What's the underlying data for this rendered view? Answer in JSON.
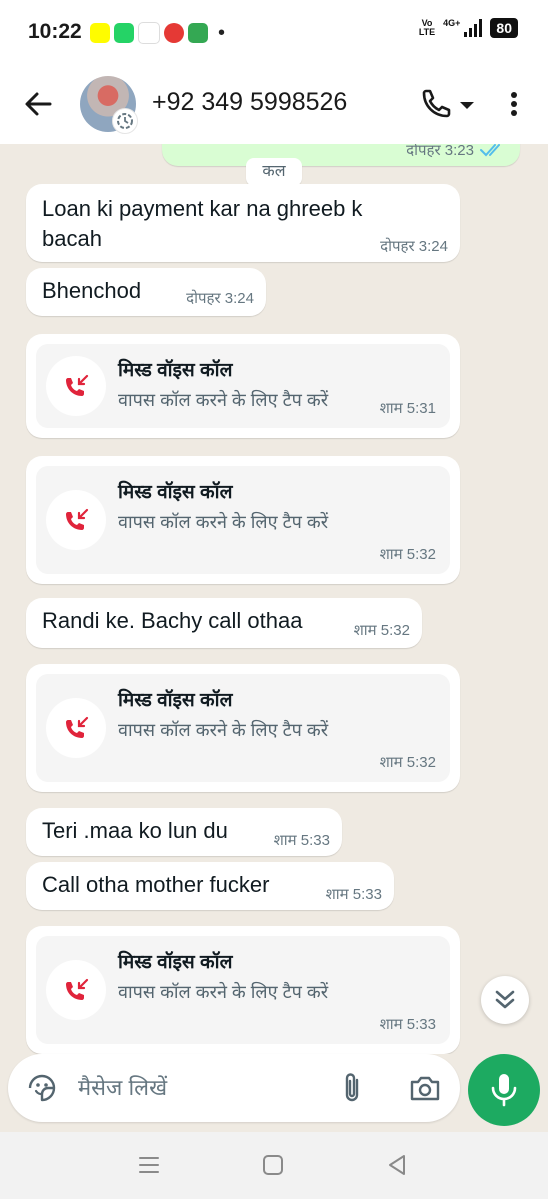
{
  "status_bar": {
    "time": "10:22",
    "notification_icons": [
      "snapchat-icon",
      "whatsapp-icon",
      "news-app-icon",
      "app-icon",
      "messages-icon"
    ],
    "dot": "•",
    "volte_top": "Vo",
    "volte_bottom": "LTE",
    "network": "4G+",
    "battery": "80"
  },
  "header": {
    "contact_name": "+92 349 5998526"
  },
  "chat": {
    "top_partial": {
      "time": "दोपहर 3:23"
    },
    "date_chip": "कल",
    "messages": [
      {
        "type": "text",
        "direction": "in",
        "text_line1": "Loan ki payment kar na ghreeb k",
        "text_line2": "bacah",
        "time": "दोपहर 3:24"
      },
      {
        "type": "text",
        "direction": "in",
        "text": "Bhenchod",
        "time": "दोपहर 3:24"
      },
      {
        "type": "call",
        "title": "मिस्ड  वॉइस कॉल",
        "subtitle": "वापस कॉल करने के लिए टैप करें",
        "time": "शाम 5:31"
      },
      {
        "type": "call",
        "title": "मिस्ड  वॉइस कॉल",
        "subtitle": "वापस कॉल करने के लिए टैप करें",
        "time": "शाम 5:32"
      },
      {
        "type": "text",
        "direction": "in",
        "text": "Randi ke. Bachy call othaa",
        "time": "शाम 5:32"
      },
      {
        "type": "call",
        "title": "मिस्ड  वॉइस कॉल",
        "subtitle": "वापस कॉल करने के लिए टैप करें",
        "time": "शाम 5:32"
      },
      {
        "type": "text",
        "direction": "in",
        "text": "Teri .maa ko lun du",
        "time": "शाम 5:33"
      },
      {
        "type": "text",
        "direction": "in",
        "text": "Call otha mother fucker",
        "time": "शाम 5:33"
      },
      {
        "type": "call",
        "title": "मिस्ड  वॉइस कॉल",
        "subtitle": "वापस कॉल करने के लिए टैप करें",
        "time": "शाम 5:33"
      }
    ]
  },
  "composer": {
    "placeholder": "मैसेज लिखें"
  },
  "colors": {
    "accent_green": "#1daa61",
    "missed_call_red": "#e0243b",
    "chat_bg": "#efeae2",
    "outgoing_bubble": "#d9fdd3",
    "read_tick": "#53bdeb"
  }
}
